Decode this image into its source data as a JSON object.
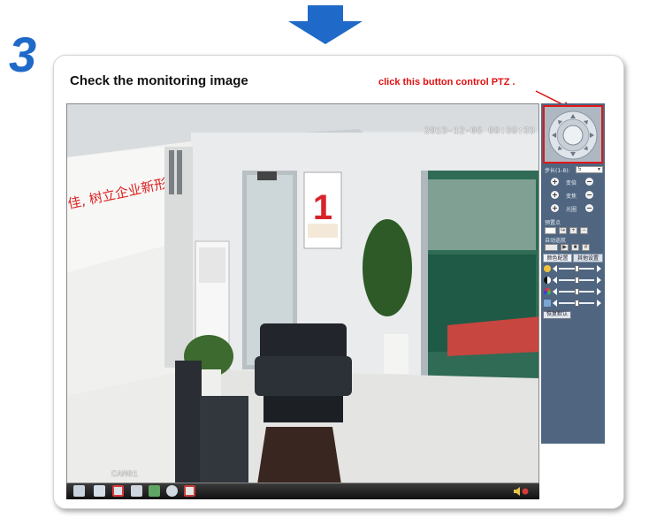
{
  "step_number": "3",
  "heading": "Check the monitoring image",
  "annotation": "click this button control PTZ .",
  "video": {
    "timestamp": "2013-12-05 09:39:33",
    "camera_label": "CAM01",
    "wall_text": "佳, 树立企业新形象",
    "poster_number": "1"
  },
  "ptz_panel": {
    "step_label": "步长(1-8):",
    "step_value": "5",
    "controls": [
      {
        "label": "变倍"
      },
      {
        "label": "变焦"
      },
      {
        "label": "光圈"
      }
    ],
    "preset_label": "预置点",
    "cruise_label": "自动巡航",
    "tabs": [
      "颜色配置",
      "其他设置"
    ],
    "reset_label": "恢复默认"
  },
  "colors": {
    "accent_blue": "#1f69c8",
    "annotation_red": "#e01010",
    "panel_bg": "#4f6580"
  }
}
